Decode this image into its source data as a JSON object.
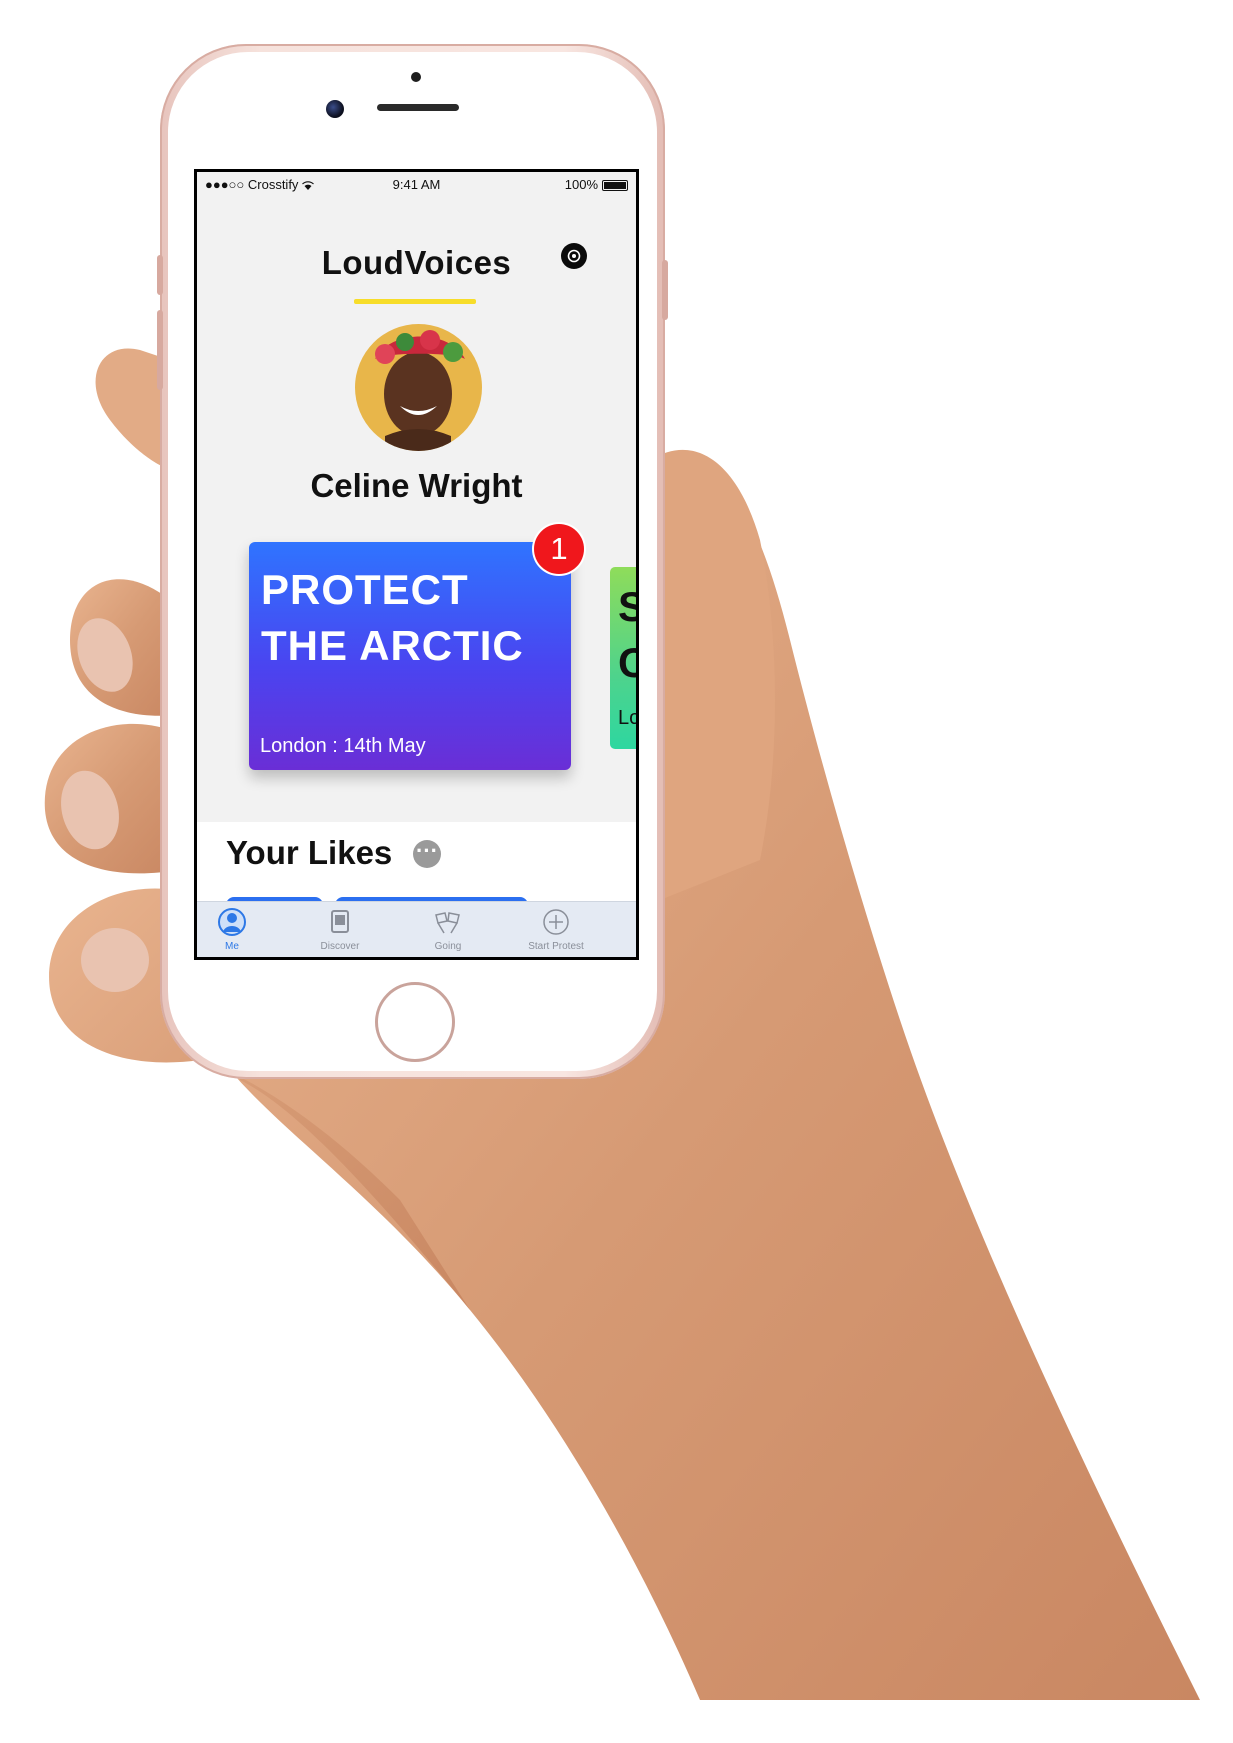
{
  "status_bar": {
    "carrier": "●●●○○ Crosstify",
    "time": "9:41 AM",
    "battery": "100%"
  },
  "header": {
    "app_title": "LoudVoices",
    "settings_icon": "gear-icon"
  },
  "profile": {
    "name": "Celine Wright"
  },
  "events": [
    {
      "title": "PROTECT THE ARCTIC",
      "meta": "London : 14th May",
      "badge": "1",
      "gradient": [
        "#2f74ff",
        "#6a2ed6"
      ]
    },
    {
      "title": "S C",
      "meta": "Lo",
      "gradient": [
        "#8fdc5a",
        "#2ed7a0"
      ]
    }
  ],
  "likes": {
    "title": "Your Likes",
    "more_icon": "ellipsis-icon"
  },
  "tabbar": {
    "tabs": [
      {
        "label": "Me",
        "icon": "person-icon",
        "active": true
      },
      {
        "label": "Discover",
        "icon": "document-icon",
        "active": false
      },
      {
        "label": "Going",
        "icon": "flags-icon",
        "active": false
      },
      {
        "label": "Start Protest",
        "icon": "plus-circle-icon",
        "active": false
      }
    ]
  },
  "colors": {
    "accent_underline": "#f7dd2a",
    "badge": "#f0171c",
    "tab_active": "#2d78e6"
  }
}
